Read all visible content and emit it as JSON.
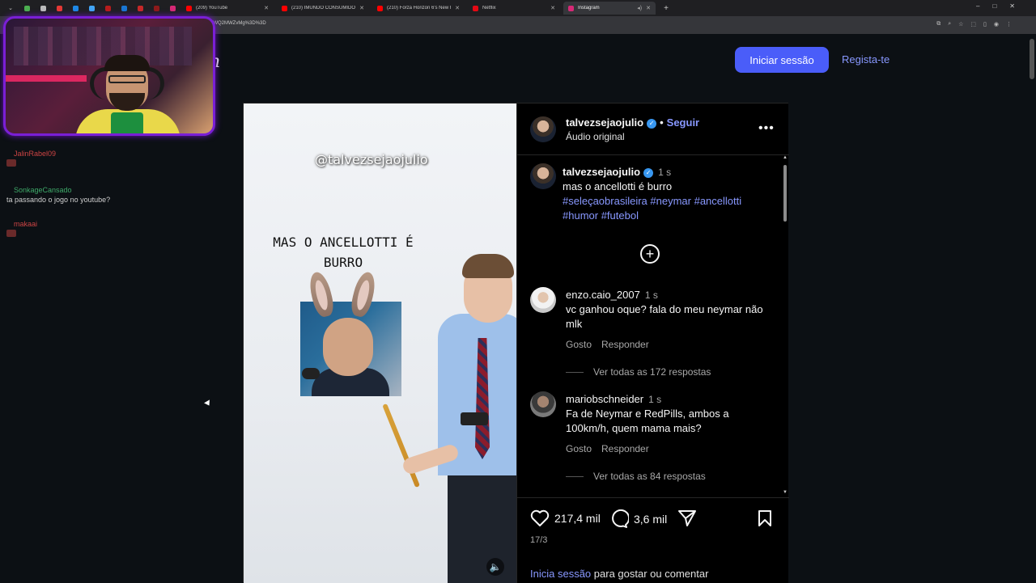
{
  "browser": {
    "tabs": [
      {
        "label": "(209) YouTube",
        "color": "#ff0000"
      },
      {
        "label": "(210) IMUNDO CONSUMIDOR",
        "color": "#ff0000"
      },
      {
        "label": "(210) Forza Horizon 6's New R...",
        "color": "#ff0000"
      },
      {
        "label": "Netflix",
        "color": "#e50914"
      },
      {
        "label": "Instagram",
        "color": "#d62976"
      }
    ],
    "address": "3ZqcWQ2MWZvMg%3D%3D"
  },
  "chat": [
    {
      "user": "JalinRabel09",
      "message": "",
      "emote": true
    },
    {
      "user": "SonkageCansado",
      "message": "ta passando o jogo no youtube?",
      "emote": false
    },
    {
      "user": "makaai",
      "message": "",
      "emote": true
    }
  ],
  "instagram": {
    "logo_fragment": "n",
    "login_button": "Iniciar sessão",
    "signup_link": "Regista-te",
    "post": {
      "overlay_handle": "@talvezsejaojulio",
      "overlay_caption": "MAS O ANCELLOTTI É BURRO",
      "author": "talvezsejaojulio",
      "follow": "Seguir",
      "audio": "Áudio original",
      "caption_time": "1 s",
      "caption_text": "mas o ancellotti é burro",
      "caption_tags": "#seleçaobrasileira #neymar #ancellotti #humor #futebol",
      "comments": [
        {
          "user": "enzo.caio_2007",
          "time": "1 s",
          "text": "vc ganhou oque? fala do meu neymar não mlk",
          "like": "Gosto",
          "reply": "Responder",
          "view_replies": "Ver todas as 172 respostas"
        },
        {
          "user": "mariobschneider",
          "time": "1 s",
          "text": "Fa de Neymar e RedPills, ambos a 100km/h, quem mama mais?",
          "like": "Gosto",
          "reply": "Responder",
          "view_replies": "Ver todas as 84 respostas"
        }
      ],
      "likes": "217,4 mil",
      "comments_count": "3,6 mil",
      "date": "17/3",
      "login_prompt_link": "Inicia sessão",
      "login_prompt_rest": "para gostar ou comentar"
    }
  },
  "colors": {
    "accent": "#4a5df9",
    "link": "#8898ff",
    "background": "#0c1014"
  }
}
